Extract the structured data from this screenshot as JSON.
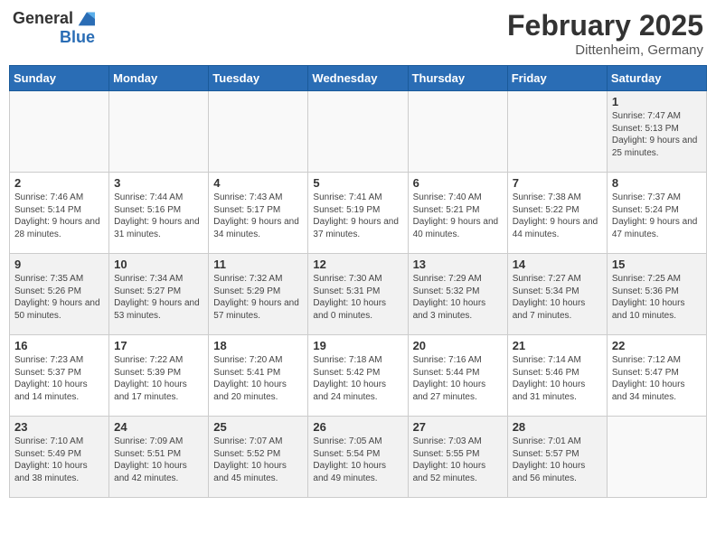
{
  "header": {
    "logo_general": "General",
    "logo_blue": "Blue",
    "month_year": "February 2025",
    "location": "Dittenheim, Germany"
  },
  "days_of_week": [
    "Sunday",
    "Monday",
    "Tuesday",
    "Wednesday",
    "Thursday",
    "Friday",
    "Saturday"
  ],
  "weeks": [
    [
      {
        "day": "",
        "info": ""
      },
      {
        "day": "",
        "info": ""
      },
      {
        "day": "",
        "info": ""
      },
      {
        "day": "",
        "info": ""
      },
      {
        "day": "",
        "info": ""
      },
      {
        "day": "",
        "info": ""
      },
      {
        "day": "1",
        "info": "Sunrise: 7:47 AM\nSunset: 5:13 PM\nDaylight: 9 hours and 25 minutes."
      }
    ],
    [
      {
        "day": "2",
        "info": "Sunrise: 7:46 AM\nSunset: 5:14 PM\nDaylight: 9 hours and 28 minutes."
      },
      {
        "day": "3",
        "info": "Sunrise: 7:44 AM\nSunset: 5:16 PM\nDaylight: 9 hours and 31 minutes."
      },
      {
        "day": "4",
        "info": "Sunrise: 7:43 AM\nSunset: 5:17 PM\nDaylight: 9 hours and 34 minutes."
      },
      {
        "day": "5",
        "info": "Sunrise: 7:41 AM\nSunset: 5:19 PM\nDaylight: 9 hours and 37 minutes."
      },
      {
        "day": "6",
        "info": "Sunrise: 7:40 AM\nSunset: 5:21 PM\nDaylight: 9 hours and 40 minutes."
      },
      {
        "day": "7",
        "info": "Sunrise: 7:38 AM\nSunset: 5:22 PM\nDaylight: 9 hours and 44 minutes."
      },
      {
        "day": "8",
        "info": "Sunrise: 7:37 AM\nSunset: 5:24 PM\nDaylight: 9 hours and 47 minutes."
      }
    ],
    [
      {
        "day": "9",
        "info": "Sunrise: 7:35 AM\nSunset: 5:26 PM\nDaylight: 9 hours and 50 minutes."
      },
      {
        "day": "10",
        "info": "Sunrise: 7:34 AM\nSunset: 5:27 PM\nDaylight: 9 hours and 53 minutes."
      },
      {
        "day": "11",
        "info": "Sunrise: 7:32 AM\nSunset: 5:29 PM\nDaylight: 9 hours and 57 minutes."
      },
      {
        "day": "12",
        "info": "Sunrise: 7:30 AM\nSunset: 5:31 PM\nDaylight: 10 hours and 0 minutes."
      },
      {
        "day": "13",
        "info": "Sunrise: 7:29 AM\nSunset: 5:32 PM\nDaylight: 10 hours and 3 minutes."
      },
      {
        "day": "14",
        "info": "Sunrise: 7:27 AM\nSunset: 5:34 PM\nDaylight: 10 hours and 7 minutes."
      },
      {
        "day": "15",
        "info": "Sunrise: 7:25 AM\nSunset: 5:36 PM\nDaylight: 10 hours and 10 minutes."
      }
    ],
    [
      {
        "day": "16",
        "info": "Sunrise: 7:23 AM\nSunset: 5:37 PM\nDaylight: 10 hours and 14 minutes."
      },
      {
        "day": "17",
        "info": "Sunrise: 7:22 AM\nSunset: 5:39 PM\nDaylight: 10 hours and 17 minutes."
      },
      {
        "day": "18",
        "info": "Sunrise: 7:20 AM\nSunset: 5:41 PM\nDaylight: 10 hours and 20 minutes."
      },
      {
        "day": "19",
        "info": "Sunrise: 7:18 AM\nSunset: 5:42 PM\nDaylight: 10 hours and 24 minutes."
      },
      {
        "day": "20",
        "info": "Sunrise: 7:16 AM\nSunset: 5:44 PM\nDaylight: 10 hours and 27 minutes."
      },
      {
        "day": "21",
        "info": "Sunrise: 7:14 AM\nSunset: 5:46 PM\nDaylight: 10 hours and 31 minutes."
      },
      {
        "day": "22",
        "info": "Sunrise: 7:12 AM\nSunset: 5:47 PM\nDaylight: 10 hours and 34 minutes."
      }
    ],
    [
      {
        "day": "23",
        "info": "Sunrise: 7:10 AM\nSunset: 5:49 PM\nDaylight: 10 hours and 38 minutes."
      },
      {
        "day": "24",
        "info": "Sunrise: 7:09 AM\nSunset: 5:51 PM\nDaylight: 10 hours and 42 minutes."
      },
      {
        "day": "25",
        "info": "Sunrise: 7:07 AM\nSunset: 5:52 PM\nDaylight: 10 hours and 45 minutes."
      },
      {
        "day": "26",
        "info": "Sunrise: 7:05 AM\nSunset: 5:54 PM\nDaylight: 10 hours and 49 minutes."
      },
      {
        "day": "27",
        "info": "Sunrise: 7:03 AM\nSunset: 5:55 PM\nDaylight: 10 hours and 52 minutes."
      },
      {
        "day": "28",
        "info": "Sunrise: 7:01 AM\nSunset: 5:57 PM\nDaylight: 10 hours and 56 minutes."
      },
      {
        "day": "",
        "info": ""
      }
    ]
  ]
}
